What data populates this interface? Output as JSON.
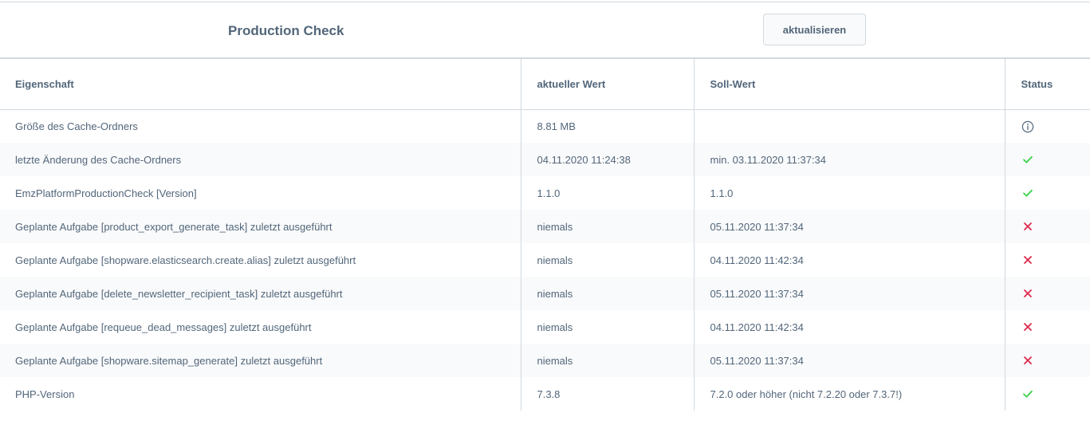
{
  "header": {
    "title": "Production Check",
    "refresh_label": "aktualisieren"
  },
  "table": {
    "columns": [
      "Eigenschaft",
      "aktueller Wert",
      "Soll-Wert",
      "Status"
    ],
    "rows": [
      {
        "property": "Größe des Cache-Ordners",
        "current": "8.81 MB",
        "target": "",
        "status": "info-icon"
      },
      {
        "property": "letzte Änderung des Cache-Ordners",
        "current": "04.11.2020 11:24:38",
        "target": "min. 03.11.2020 11:37:34",
        "status": "check-icon"
      },
      {
        "property": "EmzPlatformProductionCheck [Version]",
        "current": "1.1.0",
        "target": "1.1.0",
        "status": "check-icon"
      },
      {
        "property": "Geplante Aufgabe [product_export_generate_task] zuletzt ausgeführt",
        "current": "niemals",
        "target": "05.11.2020 11:37:34",
        "status": "cross-icon"
      },
      {
        "property": "Geplante Aufgabe [shopware.elasticsearch.create.alias] zuletzt ausgeführt",
        "current": "niemals",
        "target": "04.11.2020 11:42:34",
        "status": "cross-icon"
      },
      {
        "property": "Geplante Aufgabe [delete_newsletter_recipient_task] zuletzt ausgeführt",
        "current": "niemals",
        "target": "05.11.2020 11:37:34",
        "status": "cross-icon"
      },
      {
        "property": "Geplante Aufgabe [requeue_dead_messages] zuletzt ausgeführt",
        "current": "niemals",
        "target": "04.11.2020 11:42:34",
        "status": "cross-icon"
      },
      {
        "property": "Geplante Aufgabe [shopware.sitemap_generate] zuletzt ausgeführt",
        "current": "niemals",
        "target": "05.11.2020 11:37:34",
        "status": "cross-icon"
      },
      {
        "property": "PHP-Version",
        "current": "7.3.8",
        "target": "7.2.0 oder höher (nicht 7.2.20 oder 7.3.7!)",
        "status": "check-icon"
      }
    ]
  },
  "colors": {
    "text": "#52667a",
    "border": "#d1d9e0",
    "row_alt": "#f9fafb",
    "success": "#37d046",
    "error": "#de294c",
    "info": "#52667a"
  }
}
